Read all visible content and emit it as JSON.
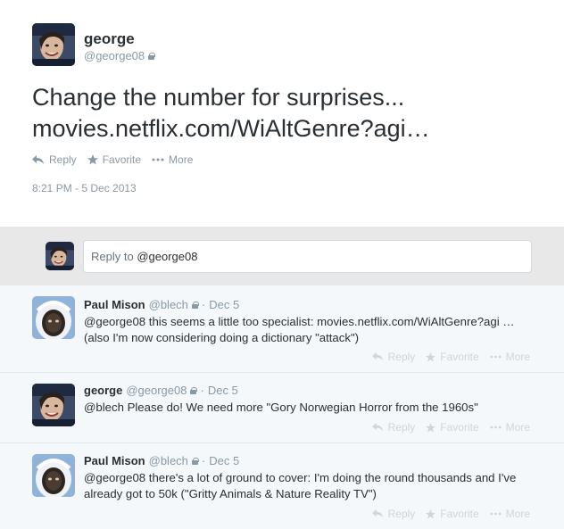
{
  "main_tweet": {
    "name": "george",
    "handle": "@george08",
    "text_line1": "Change the number for surprises...",
    "text_line2": "movies.netflix.com/WiAltGenre?agi…",
    "actions": {
      "reply": "Reply",
      "favorite": "Favorite",
      "more": "More"
    },
    "timestamp": "8:21 PM - 5 Dec 2013"
  },
  "reply_box": {
    "prefix": "Reply to ",
    "mention": "@george08"
  },
  "replies": [
    {
      "name": "Paul Mison",
      "handle": "@blech",
      "dot": "·",
      "date": "Dec 5",
      "text": "@george08 this seems a little too specialist: movies.netflix.com/WiAltGenre?agi … (also I'm now considering doing a dictionary \"attack\")",
      "actions": {
        "reply": "Reply",
        "favorite": "Favorite",
        "more": "More"
      }
    },
    {
      "name": "george",
      "handle": "@george08",
      "dot": "·",
      "date": "Dec 5",
      "text": "@blech Please do! We need more \"Gory Norwegian Horror from the 1960s\"",
      "actions": {
        "reply": "Reply",
        "favorite": "Favorite",
        "more": "More"
      }
    },
    {
      "name": "Paul Mison",
      "handle": "@blech",
      "dot": "·",
      "date": "Dec 5",
      "text": "@george08 there's a lot of ground to cover: I'm doing the round thousands and I've already got to 50k (\"Gritty Animals & Nature Reality TV\")",
      "actions": {
        "reply": "Reply",
        "favorite": "Favorite",
        "more": "More"
      }
    }
  ],
  "colors": {
    "secondary_text": "#8899a6",
    "primary_text": "#292f33",
    "replies_bg": "#f5f8fa",
    "reply_box_bg": "#e8e8e8"
  }
}
